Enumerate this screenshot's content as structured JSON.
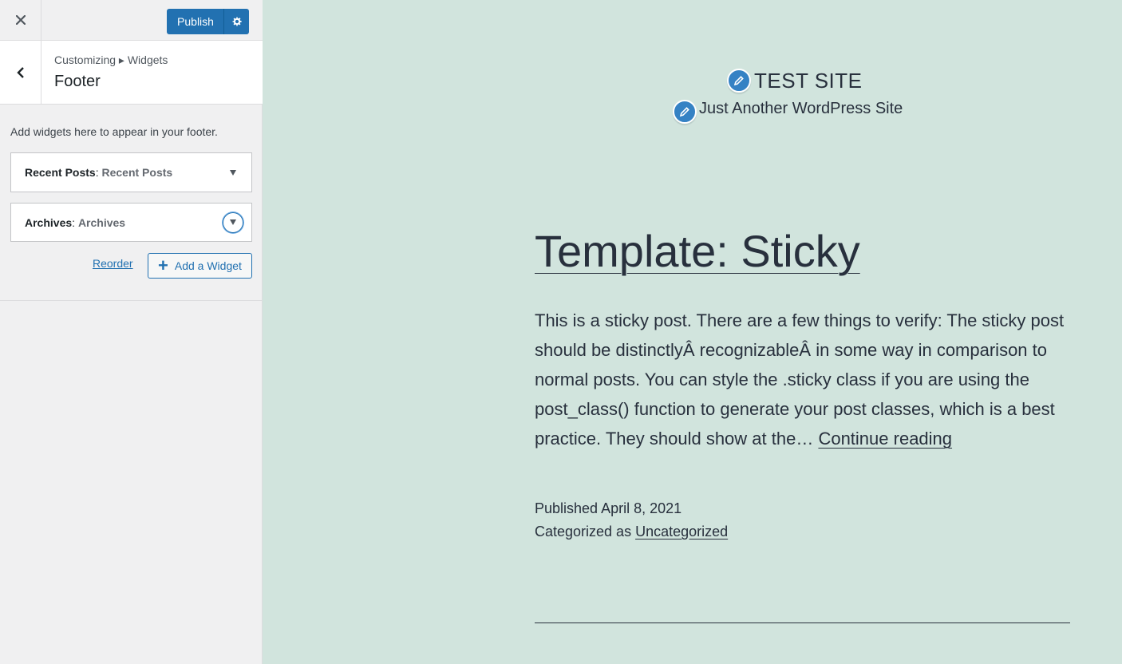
{
  "customizer": {
    "close_label": "Close",
    "publish_label": "Publish",
    "breadcrumb": "Customizing ▸ Widgets",
    "section_title": "Footer",
    "description": "Add widgets here to appear in your footer.",
    "widgets": [
      {
        "type": "Recent Posts",
        "title": "Recent Posts"
      },
      {
        "type": "Archives",
        "title": "Archives"
      }
    ],
    "reorder_label": "Reorder",
    "add_widget_label": "Add a Widget",
    "accent_color": "#2271b1"
  },
  "preview": {
    "site_title": "TEST SITE",
    "site_tagline": "Just Another WordPress Site",
    "post_title": "Template: Sticky",
    "excerpt": "This is a sticky post. There are a few things to verify: The sticky post should be distinctlyÂ recognizableÂ in some way in comparison to normal posts. You can style the .sticky class if you are using the post_class() function to generate your post classes, which is a best practice. They should show at the… ",
    "continue_reading": "Continue reading",
    "published_label": "Published April 8, 2021",
    "categorized_prefix": "Categorized as ",
    "category": "Uncategorized",
    "background_color": "#d1e4dd"
  }
}
